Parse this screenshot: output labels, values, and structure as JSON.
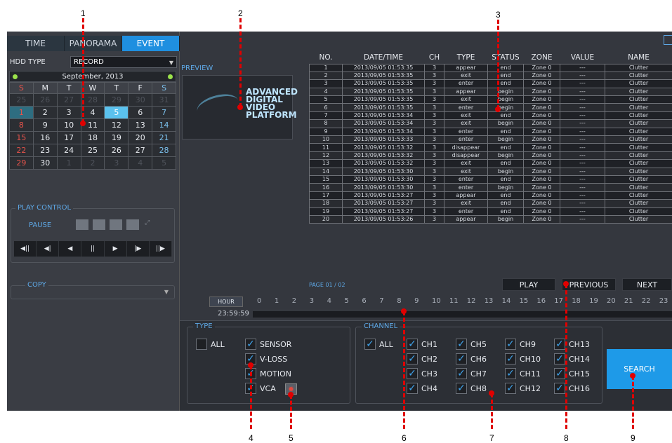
{
  "tabs": [
    "TIME",
    "PANORAMA",
    "EVENT"
  ],
  "hdd": {
    "label": "HDD TYPE",
    "value": "RECORD"
  },
  "calendar": {
    "month": "September",
    "year": "2013",
    "weekdays": [
      "S",
      "M",
      "T",
      "W",
      "T",
      "F",
      "S"
    ],
    "weeks": [
      [
        "25",
        "26",
        "27",
        "28",
        "29",
        "30",
        "31"
      ],
      [
        "1",
        "2",
        "3",
        "4",
        "5",
        "6",
        "7"
      ],
      [
        "8",
        "9",
        "10",
        "11",
        "12",
        "13",
        "14"
      ],
      [
        "15",
        "16",
        "17",
        "18",
        "19",
        "20",
        "21"
      ],
      [
        "22",
        "23",
        "24",
        "25",
        "26",
        "27",
        "28"
      ],
      [
        "29",
        "30",
        "1",
        "2",
        "3",
        "4",
        "5"
      ]
    ],
    "selected_day": "1",
    "today_day": "5"
  },
  "play_control": {
    "legend": "PLAY CONTROL",
    "pause_label": "PAUSE",
    "buttons": [
      "◀||",
      "◀|",
      "◀",
      "||",
      "▶",
      "|▶",
      "||▶"
    ]
  },
  "copy": {
    "legend": "COPY"
  },
  "preview": {
    "label": "PREVIEW",
    "logo_lines": [
      "ADVANCED",
      "DIGITAL",
      "VIDEO",
      "PLATFORM"
    ]
  },
  "table": {
    "headers": [
      "NO.",
      "DATE/TIME",
      "CH",
      "TYPE",
      "STATUS",
      "ZONE",
      "VALUE",
      "NAME"
    ],
    "rows": [
      [
        "1",
        "2013/09/05 01:53:35",
        "3",
        "appear",
        "end",
        "Zone 0",
        "---",
        "Clutter"
      ],
      [
        "2",
        "2013/09/05 01:53:35",
        "3",
        "exit",
        "end",
        "Zone 0",
        "---",
        "Clutter"
      ],
      [
        "3",
        "2013/09/05 01:53:35",
        "3",
        "enter",
        "end",
        "Zone 0",
        "---",
        "Clutter"
      ],
      [
        "4",
        "2013/09/05 01:53:35",
        "3",
        "appear",
        "begin",
        "Zone 0",
        "---",
        "Clutter"
      ],
      [
        "5",
        "2013/09/05 01:53:35",
        "3",
        "exit",
        "begin",
        "Zone 0",
        "---",
        "Clutter"
      ],
      [
        "6",
        "2013/09/05 01:53:35",
        "3",
        "enter",
        "begin",
        "Zone 0",
        "---",
        "Clutter"
      ],
      [
        "7",
        "2013/09/05 01:53:34",
        "3",
        "exit",
        "end",
        "Zone 0",
        "---",
        "Clutter"
      ],
      [
        "8",
        "2013/09/05 01:53:34",
        "3",
        "exit",
        "begin",
        "Zone 0",
        "---",
        "Clutter"
      ],
      [
        "9",
        "2013/09/05 01:53:34",
        "3",
        "enter",
        "end",
        "Zone 0",
        "---",
        "Clutter"
      ],
      [
        "10",
        "2013/09/05 01:53:33",
        "3",
        "enter",
        "begin",
        "Zone 0",
        "---",
        "Clutter"
      ],
      [
        "11",
        "2013/09/05 01:53:32",
        "3",
        "disappear",
        "end",
        "Zone 0",
        "---",
        "Clutter"
      ],
      [
        "12",
        "2013/09/05 01:53:32",
        "3",
        "disappear",
        "begin",
        "Zone 0",
        "---",
        "Clutter"
      ],
      [
        "13",
        "2013/09/05 01:53:32",
        "3",
        "exit",
        "end",
        "Zone 0",
        "---",
        "Clutter"
      ],
      [
        "14",
        "2013/09/05 01:53:30",
        "3",
        "exit",
        "begin",
        "Zone 0",
        "---",
        "Clutter"
      ],
      [
        "15",
        "2013/09/05 01:53:30",
        "3",
        "enter",
        "end",
        "Zone 0",
        "---",
        "Clutter"
      ],
      [
        "16",
        "2013/09/05 01:53:30",
        "3",
        "enter",
        "begin",
        "Zone 0",
        "---",
        "Clutter"
      ],
      [
        "17",
        "2013/09/05 01:53:27",
        "3",
        "appear",
        "end",
        "Zone 0",
        "---",
        "Clutter"
      ],
      [
        "18",
        "2013/09/05 01:53:27",
        "3",
        "exit",
        "end",
        "Zone 0",
        "---",
        "Clutter"
      ],
      [
        "19",
        "2013/09/05 01:53:27",
        "3",
        "enter",
        "end",
        "Zone 0",
        "---",
        "Clutter"
      ],
      [
        "20",
        "2013/09/05 01:53:26",
        "3",
        "appear",
        "begin",
        "Zone 0",
        "---",
        "Clutter"
      ]
    ],
    "page_info": "PAGE 01 / 02"
  },
  "nav": {
    "play": "PLAY",
    "previous": "PREVIOUS",
    "next": "NEXT"
  },
  "hour": {
    "button": "HOUR",
    "scale": [
      "0",
      "1",
      "2",
      "3",
      "4",
      "5",
      "6",
      "7",
      "8",
      "9",
      "10",
      "11",
      "12",
      "13",
      "14",
      "15",
      "16",
      "17",
      "18",
      "19",
      "20",
      "21",
      "22",
      "23"
    ],
    "current_time": "23:59:59"
  },
  "type_box": {
    "legend": "TYPE",
    "all": "ALL",
    "items": [
      "SENSOR",
      "V-LOSS",
      "MOTION",
      "VCA"
    ]
  },
  "channel_box": {
    "legend": "CHANNEL",
    "all": "ALL",
    "channels": [
      "CH1",
      "CH2",
      "CH3",
      "CH4",
      "CH5",
      "CH6",
      "CH7",
      "CH8",
      "CH9",
      "CH10",
      "CH11",
      "CH12",
      "CH13",
      "CH14",
      "CH15",
      "CH16"
    ]
  },
  "search_label": "SEARCH",
  "callouts": [
    "1",
    "2",
    "3",
    "4",
    "5",
    "6",
    "7",
    "8",
    "9"
  ],
  "colors": {
    "accent": "#1f8fe0",
    "callout": "#e00000"
  }
}
